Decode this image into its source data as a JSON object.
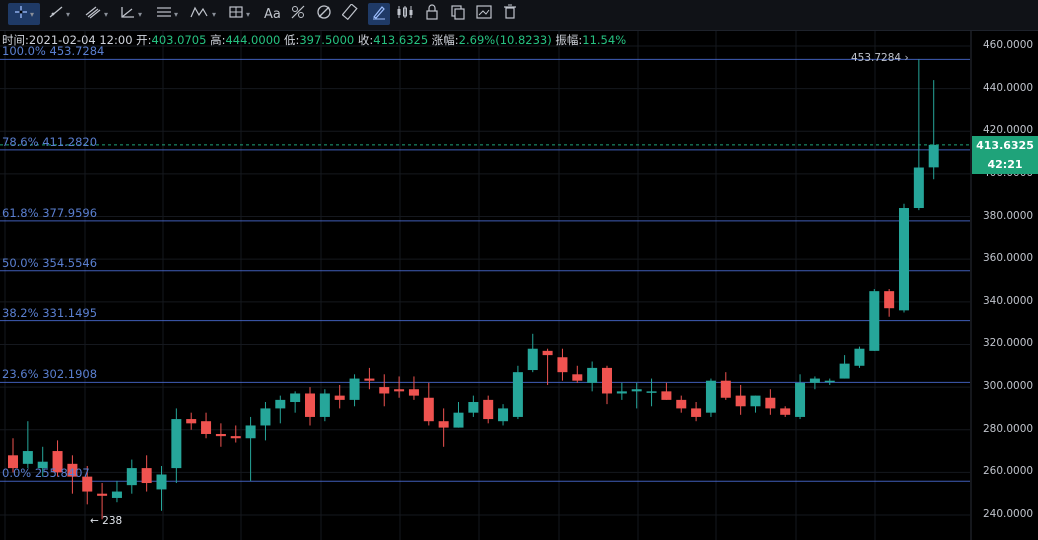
{
  "info": {
    "time_label": "时间:",
    "time_value": "2021-02-04 12:00",
    "open_label": "开:",
    "open_value": "403.0705",
    "high_label": "高:",
    "high_value": "444.0000",
    "low_label": "低:",
    "low_value": "397.5000",
    "close_label": "收:",
    "close_value": "413.6325",
    "change_label": "涨幅:",
    "change_value": "2.69%(10.8233)",
    "amplitude_label": "振幅:",
    "amplitude_value": "11.54%"
  },
  "toolbar": {
    "text_tool_label": "Aa",
    "icons": [
      "crosshair-icon",
      "trendline-icon",
      "parallel-channel-icon",
      "angle-icon",
      "horizontal-line-icon",
      "elliott-wave-icon",
      "measure-icon",
      "text-icon",
      "fibonacci-icon",
      "magnet-icon",
      "ruler-icon",
      "draw-mode-icon",
      "indicator-icon",
      "lock-icon",
      "copy-icon",
      "screenshot-icon",
      "delete-icon"
    ]
  },
  "fib_levels": [
    {
      "label": "100.0% 453.7284",
      "value": 453.7284
    },
    {
      "label": "78.6% 411.2820",
      "value": 411.282
    },
    {
      "label": "61.8% 377.9596",
      "value": 377.9596
    },
    {
      "label": "50.0% 354.5546",
      "value": 354.5546
    },
    {
      "label": "38.2% 331.1495",
      "value": 331.1495
    },
    {
      "label": "23.6% 302.1908",
      "value": 302.1908
    },
    {
      "label": "0.0% 255.8407",
      "value": 255.8407
    }
  ],
  "markers": {
    "high_label": "453.7284",
    "low_label": "← 238",
    "current_price": "413.6325",
    "countdown": "42:21"
  },
  "colors": {
    "up": "#26a69a",
    "down": "#ef5350",
    "fib_line": "#4c6fd8",
    "badge": "#1fa37a",
    "background": "#000000"
  },
  "chart_data": {
    "type": "candlestick",
    "y_axis_labels": [
      "460.0000",
      "440.0000",
      "420.0000",
      "400.0000",
      "380.0000",
      "360.0000",
      "340.0000",
      "320.0000",
      "300.0000",
      "280.0000",
      "260.0000",
      "240.0000"
    ],
    "ylim": [
      234,
      464
    ],
    "candles": [
      {
        "o": 268,
        "h": 276,
        "l": 260,
        "c": 262
      },
      {
        "o": 264,
        "h": 284,
        "l": 262,
        "c": 270
      },
      {
        "o": 262,
        "h": 272,
        "l": 258,
        "c": 265
      },
      {
        "o": 270,
        "h": 275,
        "l": 258,
        "c": 260
      },
      {
        "o": 264,
        "h": 268,
        "l": 250,
        "c": 258
      },
      {
        "o": 258,
        "h": 263,
        "l": 245,
        "c": 251
      },
      {
        "o": 250,
        "h": 255,
        "l": 238,
        "c": 249
      },
      {
        "o": 248,
        "h": 256,
        "l": 246,
        "c": 251
      },
      {
        "o": 254,
        "h": 266,
        "l": 250,
        "c": 262
      },
      {
        "o": 262,
        "h": 268,
        "l": 251,
        "c": 255
      },
      {
        "o": 252,
        "h": 263,
        "l": 242,
        "c": 259
      },
      {
        "o": 262,
        "h": 290,
        "l": 255,
        "c": 285
      },
      {
        "o": 285,
        "h": 288,
        "l": 280,
        "c": 283
      },
      {
        "o": 284,
        "h": 288,
        "l": 276,
        "c": 278
      },
      {
        "o": 278,
        "h": 283,
        "l": 272,
        "c": 277
      },
      {
        "o": 277,
        "h": 282,
        "l": 274,
        "c": 276
      },
      {
        "o": 276,
        "h": 286,
        "l": 256,
        "c": 282
      },
      {
        "o": 282,
        "h": 293,
        "l": 275,
        "c": 290
      },
      {
        "o": 290,
        "h": 296,
        "l": 283,
        "c": 294
      },
      {
        "o": 293,
        "h": 298,
        "l": 288,
        "c": 297
      },
      {
        "o": 297,
        "h": 300,
        "l": 282,
        "c": 286
      },
      {
        "o": 286,
        "h": 299,
        "l": 284,
        "c": 297
      },
      {
        "o": 296,
        "h": 301,
        "l": 290,
        "c": 294
      },
      {
        "o": 294,
        "h": 306,
        "l": 291,
        "c": 304
      },
      {
        "o": 304,
        "h": 309,
        "l": 299,
        "c": 303
      },
      {
        "o": 300,
        "h": 306,
        "l": 291,
        "c": 297
      },
      {
        "o": 299,
        "h": 305,
        "l": 295,
        "c": 298
      },
      {
        "o": 299,
        "h": 305,
        "l": 294,
        "c": 296
      },
      {
        "o": 295,
        "h": 302,
        "l": 282,
        "c": 284
      },
      {
        "o": 284,
        "h": 290,
        "l": 272,
        "c": 281
      },
      {
        "o": 281,
        "h": 293,
        "l": 281,
        "c": 288
      },
      {
        "o": 288,
        "h": 296,
        "l": 286,
        "c": 293
      },
      {
        "o": 294,
        "h": 296,
        "l": 283,
        "c": 285
      },
      {
        "o": 284,
        "h": 292,
        "l": 282,
        "c": 290
      },
      {
        "o": 286,
        "h": 310,
        "l": 285,
        "c": 307
      },
      {
        "o": 308,
        "h": 325,
        "l": 307,
        "c": 318
      },
      {
        "o": 317,
        "h": 318,
        "l": 301,
        "c": 315
      },
      {
        "o": 314,
        "h": 318,
        "l": 303,
        "c": 307
      },
      {
        "o": 306,
        "h": 310,
        "l": 302,
        "c": 303
      },
      {
        "o": 302,
        "h": 312,
        "l": 298,
        "c": 309
      },
      {
        "o": 309,
        "h": 310,
        "l": 292,
        "c": 297
      },
      {
        "o": 297,
        "h": 302,
        "l": 294,
        "c": 298
      },
      {
        "o": 298,
        "h": 302,
        "l": 290,
        "c": 299
      },
      {
        "o": 298,
        "h": 304,
        "l": 291,
        "c": 298
      },
      {
        "o": 298,
        "h": 302,
        "l": 294,
        "c": 294
      },
      {
        "o": 294,
        "h": 296,
        "l": 288,
        "c": 290
      },
      {
        "o": 290,
        "h": 293,
        "l": 284,
        "c": 286
      },
      {
        "o": 288,
        "h": 304,
        "l": 286,
        "c": 303
      },
      {
        "o": 303,
        "h": 307,
        "l": 294,
        "c": 295
      },
      {
        "o": 296,
        "h": 301,
        "l": 287,
        "c": 291
      },
      {
        "o": 291,
        "h": 296,
        "l": 288,
        "c": 296
      },
      {
        "o": 295,
        "h": 299,
        "l": 287,
        "c": 290
      },
      {
        "o": 290,
        "h": 291,
        "l": 286,
        "c": 287
      },
      {
        "o": 286,
        "h": 306,
        "l": 285,
        "c": 302
      },
      {
        "o": 302,
        "h": 305,
        "l": 299,
        "c": 304
      },
      {
        "o": 303,
        "h": 304,
        "l": 301,
        "c": 303
      },
      {
        "o": 304,
        "h": 315,
        "l": 304,
        "c": 311
      },
      {
        "o": 310,
        "h": 319,
        "l": 309,
        "c": 318
      },
      {
        "o": 317,
        "h": 346,
        "l": 317,
        "c": 345
      },
      {
        "o": 345,
        "h": 346,
        "l": 333,
        "c": 337
      },
      {
        "o": 336,
        "h": 386,
        "l": 335,
        "c": 384
      },
      {
        "o": 384,
        "h": 453.73,
        "l": 383,
        "c": 403
      },
      {
        "o": 403.07,
        "h": 444,
        "l": 397.5,
        "c": 413.63
      }
    ]
  }
}
